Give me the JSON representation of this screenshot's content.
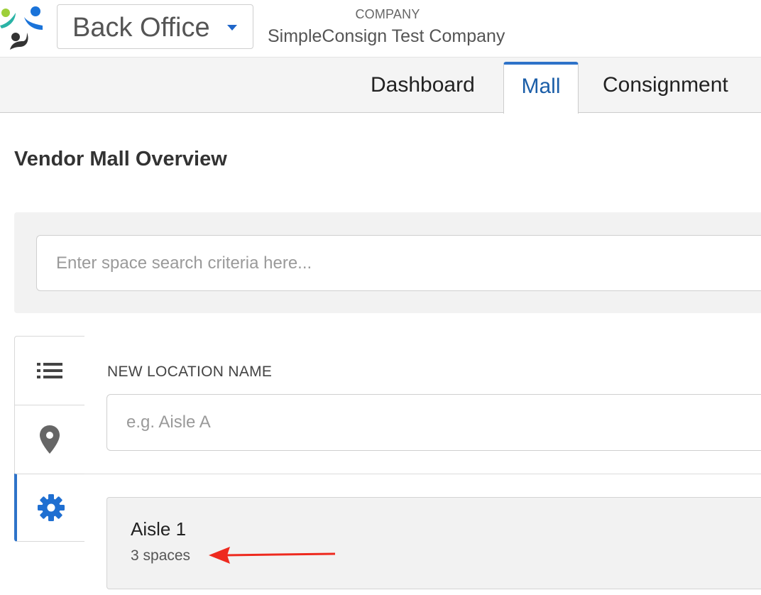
{
  "header": {
    "app_switcher_label": "Back Office",
    "company_label": "COMPANY",
    "company_name": "SimpleConsign Test Company"
  },
  "nav": {
    "tabs": [
      {
        "label": "Dashboard",
        "active": false
      },
      {
        "label": "Mall",
        "active": true
      },
      {
        "label": "Consignment",
        "active": false
      }
    ]
  },
  "page": {
    "title": "Vendor Mall Overview"
  },
  "search": {
    "placeholder": "Enter space search criteria here...",
    "value": ""
  },
  "side_tabs": [
    {
      "icon": "list-icon",
      "active": false
    },
    {
      "icon": "map-pin-icon",
      "active": false
    },
    {
      "icon": "gear-icon",
      "active": true
    }
  ],
  "location_form": {
    "label": "NEW LOCATION NAME",
    "placeholder": "e.g. Aisle A",
    "value": ""
  },
  "locations": [
    {
      "name": "Aisle 1",
      "count": "3 spaces"
    }
  ],
  "colors": {
    "accent": "#2e73c9",
    "active_tab_text": "#1b5ea8",
    "annotation_arrow": "#ee2a1f",
    "panel_bg": "#f2f2f2",
    "navbar_bg": "#f4f4f4"
  }
}
